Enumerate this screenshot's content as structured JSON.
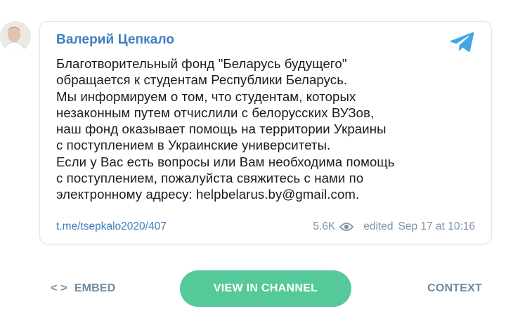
{
  "post": {
    "author": "Валерий Цепкало",
    "lines": [
      "Благотворительный фонд \"Беларусь будущего\"",
      "обращается к студентам Республики Беларусь.",
      "Мы информируем о том, что студентам, которых",
      "незаконным путем отчислили с белорусских ВУЗов,",
      "наш фонд оказывает помощь на территории Украины",
      "с поступлением в Украинские университеты.",
      "Если у Вас есть вопросы или Вам необходима помощь",
      "с поступлением, пожалуйста свяжитесь с нами по",
      "электронному адресу: helpbelarus.by@gmail.com."
    ],
    "link": "t.me/tsepkalo2020/407",
    "views": "5.6K",
    "edited_label": "edited",
    "date": "Sep 17 at 10:16"
  },
  "icons": {
    "avatar": "author-avatar",
    "telegram": "telegram-icon",
    "views": "eye-icon",
    "embed": "code-icon"
  },
  "actions": {
    "embed_icon": "< >",
    "embed_label": "EMBED",
    "view_label": "VIEW IN CHANNEL",
    "context_label": "CONTEXT"
  },
  "colors": {
    "accent": "#3e7ec0",
    "button": "#55c99a",
    "muted": "#7d94a8",
    "telegram": "#40a7e3"
  }
}
